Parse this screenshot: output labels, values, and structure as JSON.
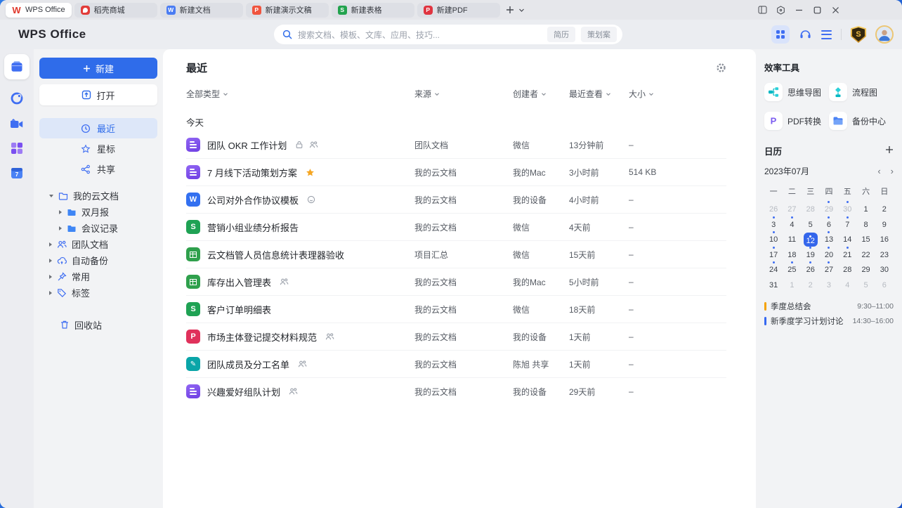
{
  "colors": {
    "accent": "#2f6cea",
    "selected_day_bg": "#3466eb",
    "event_orange": "#f5a200",
    "event_blue": "#3668f0"
  },
  "tabbar": {
    "tabs": [
      {
        "id": "home",
        "label": "WPS Office",
        "icon": "wps",
        "active": true
      },
      {
        "id": "docer",
        "label": "稻壳商城",
        "icon": "docer",
        "active": false
      },
      {
        "id": "new-doc",
        "label": "新建文档",
        "icon": "doc",
        "active": false
      },
      {
        "id": "new-ppt",
        "label": "新建演示文稿",
        "icon": "ppt",
        "active": false
      },
      {
        "id": "new-sheet",
        "label": "新建表格",
        "icon": "sheet",
        "active": false
      },
      {
        "id": "new-pdf",
        "label": "新建PDF",
        "icon": "pdf",
        "active": false
      }
    ]
  },
  "header": {
    "logo": "WPS Office",
    "search": {
      "placeholder": "搜索文档、模板、文库、应用、技巧...",
      "tags": [
        "简历",
        "策划案"
      ]
    },
    "member_badge": "S"
  },
  "rail": [
    {
      "id": "documents",
      "active": true
    },
    {
      "id": "cloud-status",
      "active": false
    },
    {
      "id": "meeting",
      "active": false
    },
    {
      "id": "apps",
      "active": false
    },
    {
      "id": "calendar",
      "active": false
    }
  ],
  "sidebar": {
    "new_label": "新建",
    "open_label": "打开",
    "nav": [
      {
        "id": "recent",
        "label": "最近",
        "icon": "clock",
        "active": true
      },
      {
        "id": "starred",
        "label": "星标",
        "icon": "star",
        "active": false
      },
      {
        "id": "shared",
        "label": "共享",
        "icon": "share",
        "active": false
      }
    ],
    "tree": [
      {
        "id": "my-cloud-docs",
        "label": "我的云文档",
        "icon": "folder",
        "expanded": true,
        "children": [
          {
            "id": "bimonthly-report",
            "label": "双月报"
          },
          {
            "id": "meeting-notes",
            "label": "会议记录"
          }
        ]
      },
      {
        "id": "team-docs",
        "label": "团队文档",
        "icon": "team",
        "expanded": false,
        "children": []
      },
      {
        "id": "auto-backup",
        "label": "自动备份",
        "icon": "cloud",
        "expanded": false,
        "children": []
      },
      {
        "id": "frequent",
        "label": "常用",
        "icon": "pin",
        "expanded": false,
        "children": []
      },
      {
        "id": "tags",
        "label": "标签",
        "icon": "tag",
        "expanded": false,
        "children": []
      }
    ],
    "trash": {
      "label": "回收站"
    }
  },
  "main": {
    "title": "最近",
    "filters": [
      "全部类型",
      "来源",
      "创建者",
      "最近查看",
      "大小"
    ],
    "group_label": "今天",
    "files": [
      {
        "name": "团队 OKR 工作计划",
        "icon": "docs",
        "badges": [
          "lock",
          "members"
        ],
        "source": "团队文档",
        "creator": "微信",
        "viewed": "13分钟前",
        "size": "–"
      },
      {
        "name": "7 月线下活动策划方案",
        "icon": "docs",
        "badges": [
          "star"
        ],
        "source": "我的云文档",
        "creator": "我的Mac",
        "viewed": "3小时前",
        "size": "514 KB"
      },
      {
        "name": "公司对外合作协议模板",
        "icon": "word",
        "badges": [
          "status"
        ],
        "source": "我的云文档",
        "creator": "我的设备",
        "viewed": "4小时前",
        "size": "–"
      },
      {
        "name": "营销小组业绩分析报告",
        "icon": "sheet",
        "badges": [],
        "source": "我的云文档",
        "creator": "微信",
        "viewed": "4天前",
        "size": "–"
      },
      {
        "name": "云文档管人员信息统计表理器验收",
        "icon": "grid",
        "badges": [],
        "source": "项目汇总",
        "creator": "微信",
        "viewed": "15天前",
        "size": "–"
      },
      {
        "name": "库存出入管理表",
        "icon": "grid",
        "badges": [
          "members"
        ],
        "source": "我的云文档",
        "creator": "我的Mac",
        "viewed": "5小时前",
        "size": "–"
      },
      {
        "name": "客户订单明细表",
        "icon": "sheet",
        "badges": [],
        "source": "我的云文档",
        "creator": "微信",
        "viewed": "18天前",
        "size": "–"
      },
      {
        "name": "市场主体登记提交材料规范",
        "icon": "pdf",
        "badges": [
          "members"
        ],
        "source": "我的云文档",
        "creator": "我的设备",
        "viewed": "1天前",
        "size": "–"
      },
      {
        "name": "团队成员及分工名单",
        "icon": "form",
        "badges": [
          "members"
        ],
        "source": "我的云文档",
        "creator": "陈旭 共享",
        "viewed": "1天前",
        "size": "–"
      },
      {
        "name": "兴趣爱好组队计划",
        "icon": "docs",
        "badges": [
          "members"
        ],
        "source": "我的云文档",
        "creator": "我的设备",
        "viewed": "29天前",
        "size": "–"
      }
    ]
  },
  "right_panel": {
    "tools_title": "效率工具",
    "tools": [
      {
        "id": "mindmap",
        "label": "思维导图"
      },
      {
        "id": "flowchart",
        "label": "流程图"
      },
      {
        "id": "pdf-convert",
        "label": "PDF转换"
      },
      {
        "id": "backup-center",
        "label": "备份中心"
      }
    ],
    "calendar": {
      "title": "日历",
      "month": "2023年07月",
      "weekdays": [
        "一",
        "二",
        "三",
        "四",
        "五",
        "六",
        "日"
      ],
      "days": [
        {
          "n": 26,
          "muted": true
        },
        {
          "n": 27,
          "muted": true
        },
        {
          "n": 28,
          "muted": true
        },
        {
          "n": 29,
          "muted": true,
          "dot": true
        },
        {
          "n": 30,
          "muted": true,
          "dot": true
        },
        {
          "n": 1
        },
        {
          "n": 2
        },
        {
          "n": 3,
          "dot": true
        },
        {
          "n": 4,
          "dot": true
        },
        {
          "n": 5
        },
        {
          "n": 6,
          "dot": true
        },
        {
          "n": 7,
          "dot": true
        },
        {
          "n": 8
        },
        {
          "n": 9
        },
        {
          "n": 10,
          "dot": true
        },
        {
          "n": 11
        },
        {
          "n": 12,
          "selected": true,
          "dot": true
        },
        {
          "n": 13,
          "dot": true
        },
        {
          "n": 14
        },
        {
          "n": 15
        },
        {
          "n": 16
        },
        {
          "n": 17,
          "dot": true
        },
        {
          "n": 18
        },
        {
          "n": 19,
          "dot": true
        },
        {
          "n": 20,
          "dot": true
        },
        {
          "n": 21,
          "dot": true
        },
        {
          "n": 22
        },
        {
          "n": 23
        },
        {
          "n": 24,
          "dot": true
        },
        {
          "n": 25,
          "dot": true
        },
        {
          "n": 26,
          "dot": true
        },
        {
          "n": 27,
          "dot": true
        },
        {
          "n": 28
        },
        {
          "n": 29
        },
        {
          "n": 30
        },
        {
          "n": 31
        },
        {
          "n": 1,
          "muted": true
        },
        {
          "n": 2,
          "muted": true
        },
        {
          "n": 3,
          "muted": true
        },
        {
          "n": 4,
          "muted": true
        },
        {
          "n": 5,
          "muted": true
        },
        {
          "n": 6,
          "muted": true
        }
      ],
      "events": [
        {
          "title": "季度总结会",
          "time": "9:30–11:00",
          "color": "#f5a200"
        },
        {
          "title": "新季度学习计划讨论",
          "time": "14:30–16:00",
          "color": "#3668f0"
        }
      ]
    }
  }
}
